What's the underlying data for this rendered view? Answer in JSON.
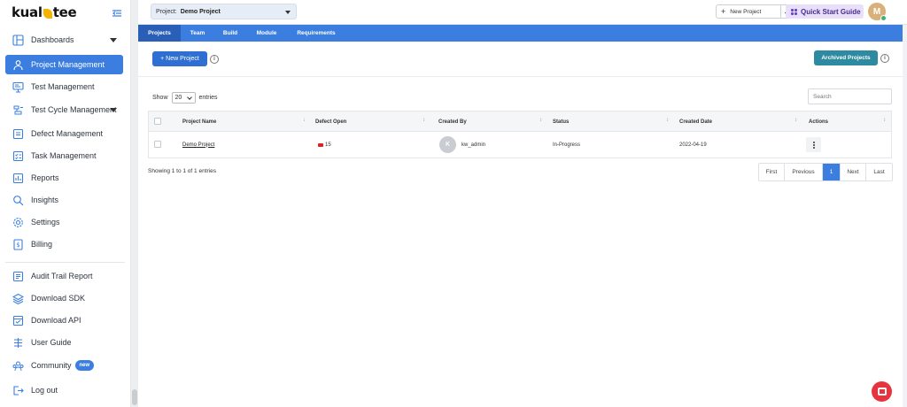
{
  "brand": {
    "name_before": "kual",
    "name_after": "tee"
  },
  "sidebar": {
    "items": [
      {
        "label": "Dashboards",
        "icon": "layout-icon",
        "has_caret": true
      },
      {
        "label": "Project Management",
        "icon": "people-icon",
        "active": true
      },
      {
        "label": "Test Management",
        "icon": "monitor-icon"
      },
      {
        "label": "Test Cycle Management",
        "icon": "cycle-icon",
        "has_caret": true
      },
      {
        "label": "Defect Management",
        "icon": "bug-icon"
      },
      {
        "label": "Task Management",
        "icon": "task-icon"
      },
      {
        "label": "Reports",
        "icon": "report-icon"
      },
      {
        "label": "Insights",
        "icon": "insights-icon"
      },
      {
        "label": "Settings",
        "icon": "gear-icon"
      },
      {
        "label": "Billing",
        "icon": "billing-icon"
      },
      {
        "label": "Audit Trail Report",
        "icon": "audit-icon"
      },
      {
        "label": "Download SDK",
        "icon": "layers-icon"
      },
      {
        "label": "Download API",
        "icon": "api-icon"
      },
      {
        "label": "User Guide",
        "icon": "guide-icon"
      },
      {
        "label": "Community",
        "icon": "community-icon",
        "badge": "new"
      },
      {
        "label": "Log out",
        "icon": "logout-icon"
      }
    ]
  },
  "topbar": {
    "project_label": "Project:",
    "project_value": "Demo Project",
    "new_project": "New Project",
    "quick_start": "Quick Start Guide",
    "avatar_initial": "M"
  },
  "tabs": [
    "Projects",
    "Team",
    "Build",
    "Module",
    "Requirements"
  ],
  "content": {
    "new_project_button": "+ New Project",
    "archived_button": "Archived Projects",
    "show_label": "Show",
    "entries_value": "20",
    "entries_label": "entries",
    "search_placeholder": "Search",
    "columns": [
      "Project Name",
      "Defect Open",
      "Created By",
      "Status",
      "Created Date",
      "Actions"
    ],
    "rows": [
      {
        "project_name": "Demo Project",
        "defect_open": "15",
        "created_by_initial": "K",
        "created_by": "kw_admin",
        "status": "In-Progress",
        "created_date": "2022-04-19"
      }
    ],
    "showing_text": "Showing 1 to 1 of 1 entries",
    "pagination": [
      "First",
      "Previous",
      "1",
      "Next",
      "Last"
    ]
  },
  "colors": {
    "accent": "#3b7ee0",
    "archived": "#2d8aa0",
    "quickstart_bg": "#e8e0fa",
    "defect_flag": "#e02020",
    "chat": "#e8333f"
  }
}
